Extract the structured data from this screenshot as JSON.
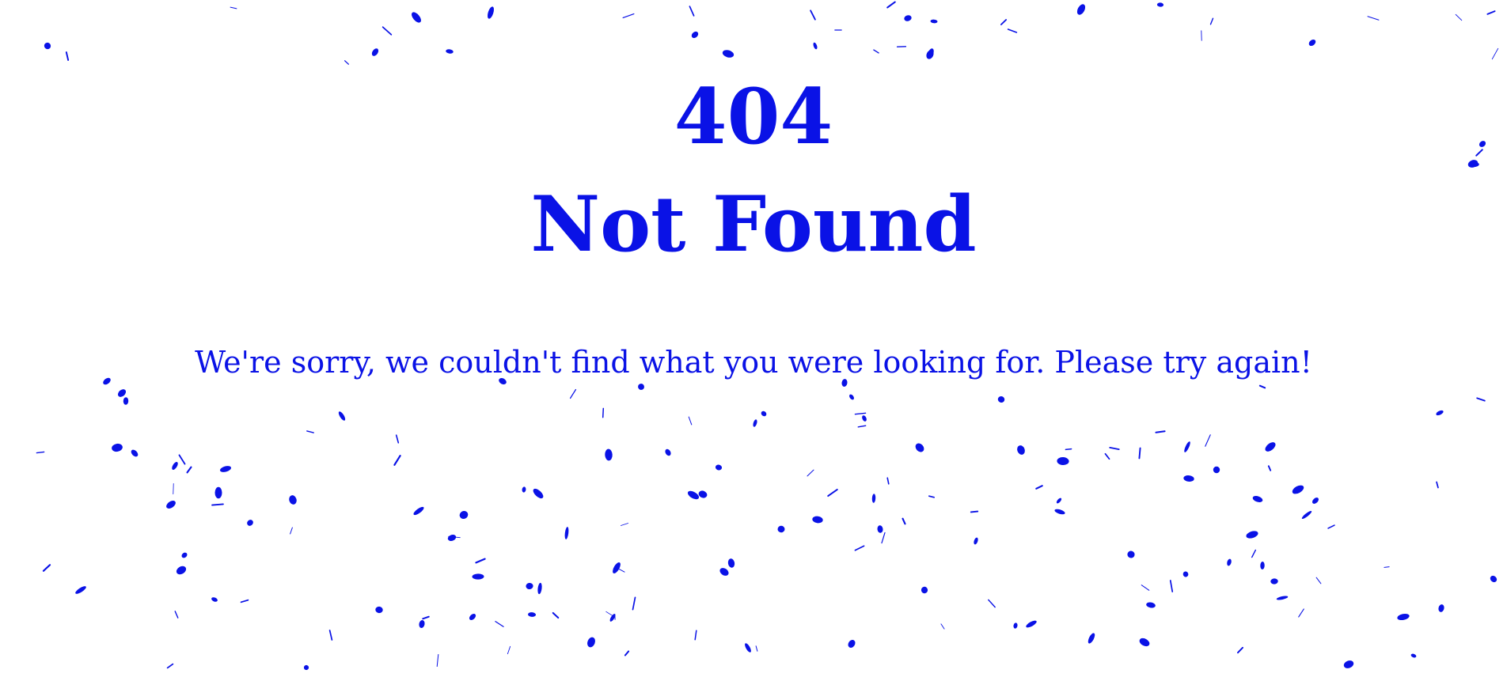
{
  "page": {
    "code": "404",
    "title": "Not Found",
    "message": "We're sorry, we couldn't find what you were looking for. Please try again!"
  },
  "theme": {
    "text_color": "#0a12e6",
    "confetti_color": "#0a12e6",
    "background": "#ffffff"
  }
}
